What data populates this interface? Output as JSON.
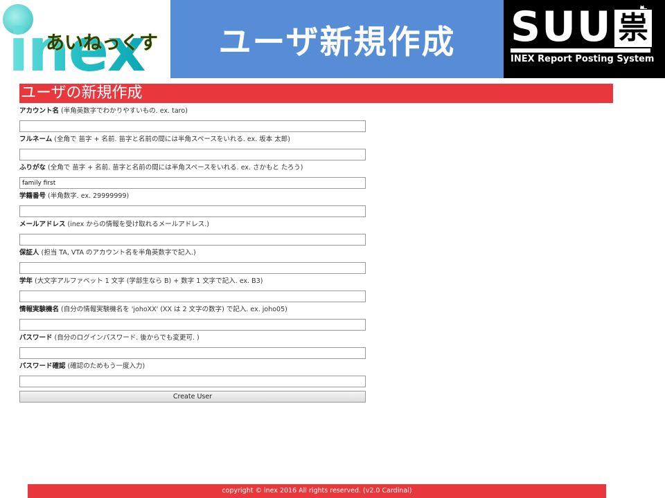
{
  "header": {
    "logo_left": {
      "wordmark": "inex",
      "kana": "あいねっくす"
    },
    "title": "ユーザ新規作成",
    "logo_right": {
      "wordmark": "SUU",
      "kanji": "祟",
      "subtitle": "INEX Report Posting System"
    }
  },
  "page": {
    "heading": "ユーザの新規作成"
  },
  "form": {
    "fields": [
      {
        "label": "アカウント名",
        "hint": "(半角英数字でわかりやすいもの. ex. taro)",
        "value": ""
      },
      {
        "label": "フルネーム",
        "hint": "(全角で 苗字 + 名前. 苗字と名前の間には半角スペースをいれる. ex. 坂本 太郎)",
        "value": ""
      },
      {
        "label": "ふりがな",
        "hint": "(全角で 苗字 + 名前. 苗字と名前の間には半角スペースをいれる. ex. さかもと たろう)",
        "value": "family first"
      },
      {
        "label": "学籍番号",
        "hint": "(半角数字. ex. 29999999)",
        "value": ""
      },
      {
        "label": "メールアドレス",
        "hint": "(inex からの情報を受け取れるメールアドレス.)",
        "value": ""
      },
      {
        "label": "保証人",
        "hint": "(担当 TA, VTA のアカウント名を半角英数字で記入.)",
        "value": ""
      },
      {
        "label": "学年",
        "hint": "(大文字アルファベット 1 文字 (学部生なら B) + 数字 1 文字で記入. ex. B3)",
        "value": ""
      },
      {
        "label": "情報実験機名",
        "hint": "(自分の情報実験機名を 'johoXX' (XX は 2 文字の数字) で記入. ex. joho05)",
        "value": ""
      },
      {
        "label": "パスワード",
        "hint": "(自分のログインパスワード. 後からでも変更可. )",
        "value": ""
      },
      {
        "label": "パスワード確認",
        "hint": "(確認のためもう一度入力)",
        "value": ""
      }
    ],
    "submit_label": "Create User"
  },
  "footer": {
    "copyright": "copyright © inex 2016 All rights reserved. (v2.0 Cardinal)"
  },
  "colors": {
    "accent_red": "#e8383d",
    "header_blue": "#568dd6",
    "logo_teal": "#25c0c6"
  }
}
